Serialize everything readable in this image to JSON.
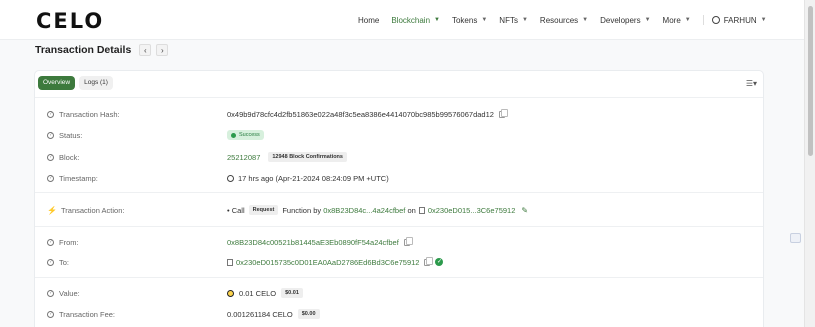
{
  "brand": {
    "logo": "CELO"
  },
  "nav": {
    "items": [
      {
        "label": "Home",
        "has_chevron": false,
        "active": false
      },
      {
        "label": "Blockchain",
        "has_chevron": true,
        "active": true
      },
      {
        "label": "Tokens",
        "has_chevron": true,
        "active": false
      },
      {
        "label": "NFTs",
        "has_chevron": true,
        "active": false
      },
      {
        "label": "Resources",
        "has_chevron": true,
        "active": false
      },
      {
        "label": "Developers",
        "has_chevron": true,
        "active": false
      },
      {
        "label": "More",
        "has_chevron": true,
        "active": false
      }
    ],
    "user": "FARHUN"
  },
  "page": {
    "title": "Transaction Details"
  },
  "tabs": [
    {
      "label": "Overview",
      "active": true
    },
    {
      "label": "Logs (1)",
      "active": false
    }
  ],
  "details": {
    "hash": {
      "label": "Transaction Hash:",
      "value": "0x49b9d78cfc4d2fb51863e022a48f3c5ea8386e4414070bc985b99576067dad12"
    },
    "status": {
      "label": "Status:",
      "value": "Success"
    },
    "block": {
      "label": "Block:",
      "value": "25212087",
      "confirmations": "12948 Block Confirmations"
    },
    "timestamp": {
      "label": "Timestamp:",
      "value": "17 hrs ago (Apr-21-2024 08:24:09 PM +UTC)"
    },
    "action": {
      "label": "Transaction Action:",
      "prefix": "• Call",
      "method": "Request",
      "function_by": "Function by",
      "from_short": "0x8B23D84c...4a24cfbef",
      "on": "on",
      "to_short": "0x230eD015...3C6e75912"
    },
    "from": {
      "label": "From:",
      "value": "0x8B23D84c00521b81445aE3Eb0890fF54a24cfbef"
    },
    "to": {
      "label": "To:",
      "value": "0x230eD015735c0D01EA0AaD2786Ed6Bd3C6e75912"
    },
    "value": {
      "label": "Value:",
      "amount": "0.01 CELO",
      "usd": "$0.01"
    },
    "fee": {
      "label": "Transaction Fee:",
      "amount": "0.001261184 CELO",
      "usd": "$0.00"
    }
  },
  "colors": {
    "accent": "#3d7a3d",
    "success": "#2c9a4c",
    "success_bg": "#d7f0dd"
  }
}
